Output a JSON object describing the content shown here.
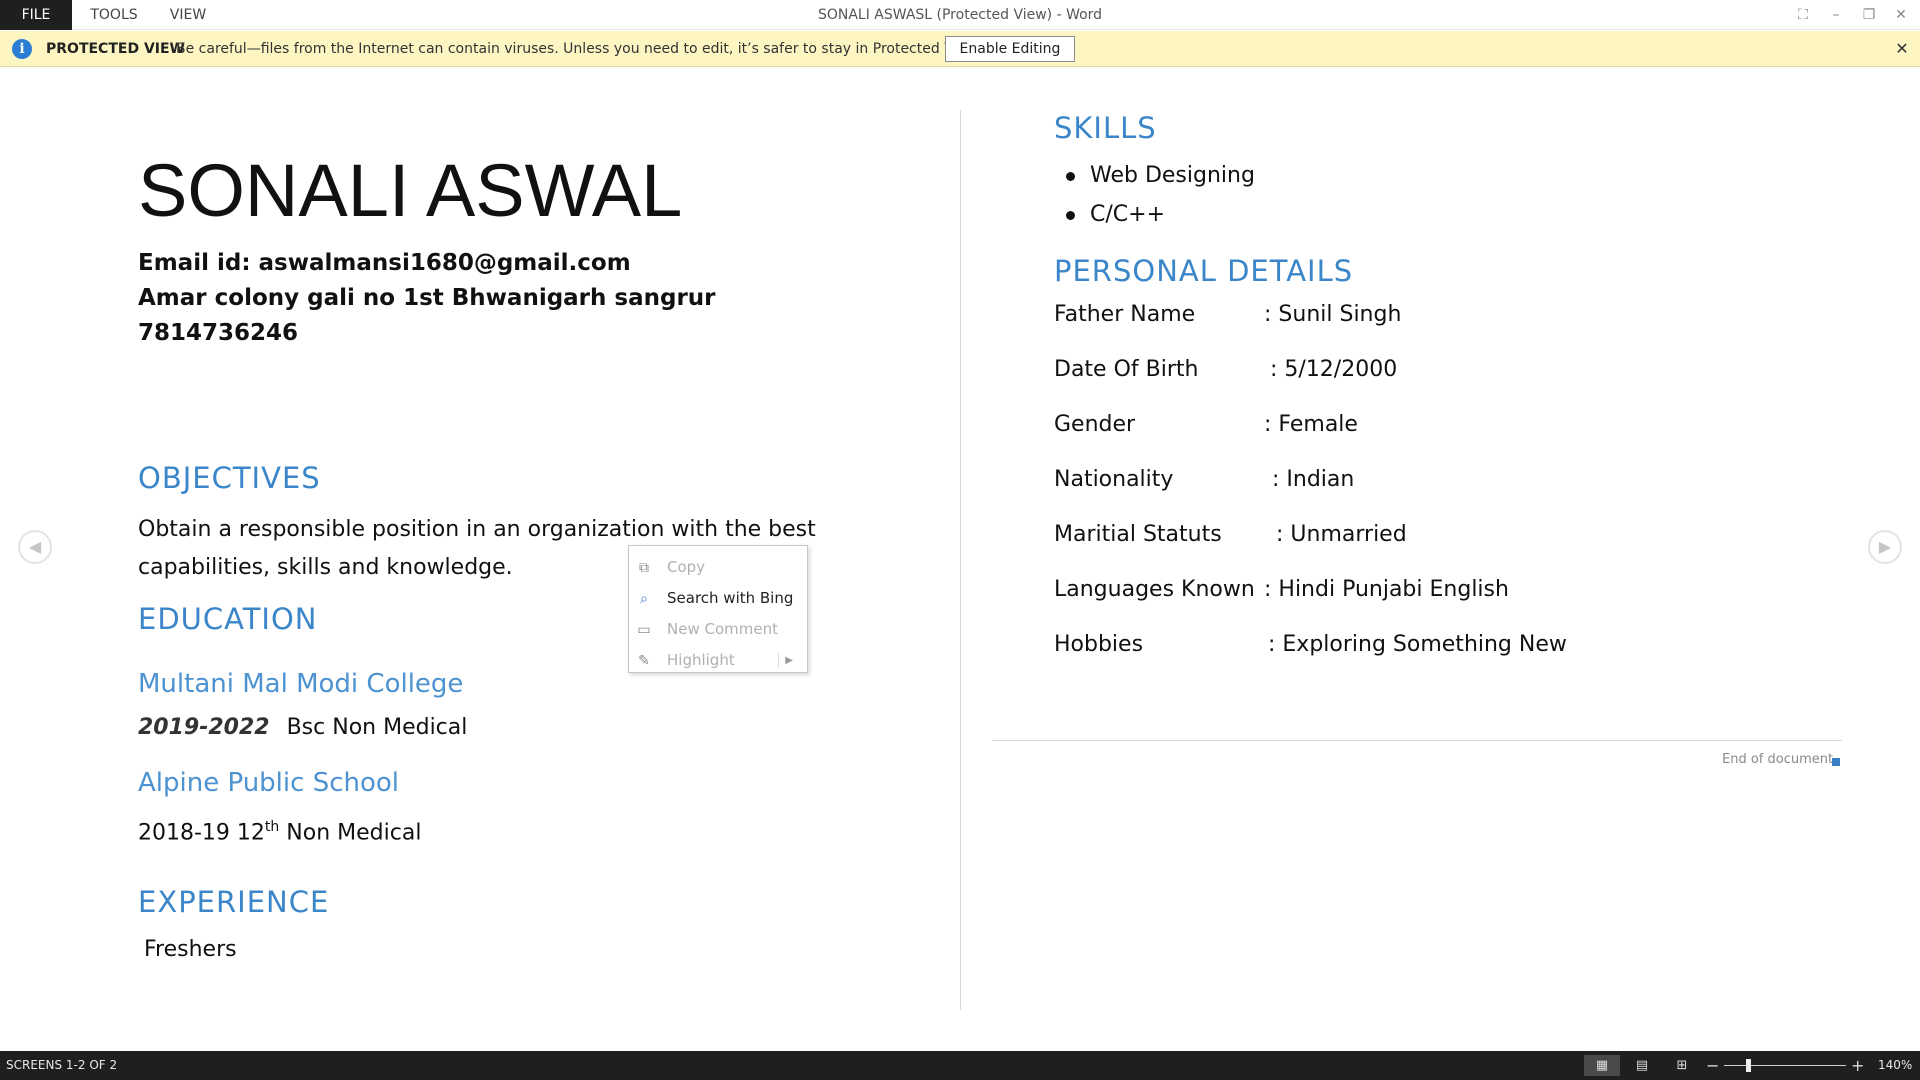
{
  "titlebar": {
    "menu": {
      "file": "FILE",
      "tools": "TOOLS",
      "view": "VIEW"
    },
    "title": "SONALI ASWASL (Protected View) - Word",
    "buttons": {
      "fullscreen": "⛶",
      "minimize": "–",
      "restore": "❐",
      "close": "✕"
    }
  },
  "protected_view": {
    "icon": "info-shield-icon",
    "icon_glyph": "i",
    "title": "PROTECTED VIEW",
    "message": "Be careful—files from the Internet can contain viruses. Unless you need to edit, it’s safer to stay in Protected View.",
    "button": "Enable Editing",
    "close": "✕"
  },
  "navigation": {
    "prev": "◀",
    "next": "▶"
  },
  "resume": {
    "name": "SONALI ASWAL",
    "email": "Email id: aswalmansi1680@gmail.com",
    "address": "Amar colony gali no 1st Bhwanigarh sangrur",
    "phone": "7814736246",
    "objectives": {
      "heading": "OBJECTIVES",
      "line1": "Obtain a responsible position in an organization with the best",
      "line2": "capabilities, skills and knowledge."
    },
    "education": {
      "heading": "EDUCATION",
      "college": {
        "name": "Multani Mal Modi College",
        "years": "2019-2022",
        "course": "Bsc Non Medical"
      },
      "school": {
        "name": "Alpine Public School",
        "years": "2018-19 12",
        "superscript": "th",
        "course": " Non Medical"
      }
    },
    "experience": {
      "heading": "EXPERIENCE",
      "text": "Freshers"
    },
    "skills": {
      "heading": "SKILLS",
      "items": [
        "Web Designing",
        "C/C++"
      ]
    },
    "personal": {
      "heading": "PERSONAL DETAILS",
      "rows": [
        {
          "label": "Father Name",
          "value": ": Sunil Singh"
        },
        {
          "label": "Date Of Birth",
          "value": " : 5/12/2000"
        },
        {
          "label": "Gender",
          "value": ": Female"
        },
        {
          "label": "Nationality",
          "value": " : Indian"
        },
        {
          "label": "Maritial Statuts",
          "value": "  : Unmarried"
        },
        {
          "label": "Languages Known",
          "value": ": Hindi Punjabi English"
        },
        {
          "label": "Hobbies",
          "value": " : Exploring Something New"
        }
      ]
    },
    "end_of_document": "End of document"
  },
  "context_menu": {
    "items": [
      {
        "label": "Copy",
        "icon": "copy-icon",
        "glyph": "⧉",
        "enabled": false
      },
      {
        "label": "Search with Bing",
        "icon": "search-bing-icon",
        "glyph": "⌕",
        "enabled": true
      },
      {
        "label": "New Comment",
        "icon": "comment-icon",
        "glyph": "▭",
        "enabled": false
      },
      {
        "label": "Highlight",
        "icon": "highlight-icon",
        "glyph": "✎",
        "enabled": false,
        "submenu_arrow": "▶"
      }
    ]
  },
  "statusbar": {
    "pages": "SCREENS 1-2 OF 2",
    "views": {
      "read": "▦",
      "print": "▤",
      "web": "⊞"
    },
    "zoom_minus": "−",
    "zoom_plus": "+",
    "zoom_level": "140%",
    "zoom_percent": 140
  }
}
